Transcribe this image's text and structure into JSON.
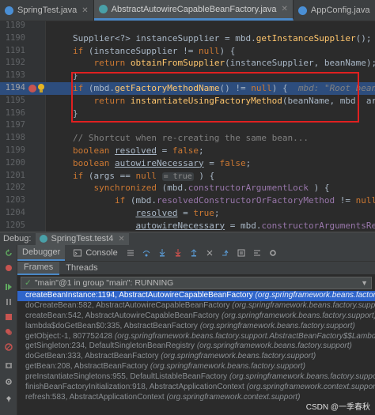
{
  "tabs": [
    {
      "label": "SpringTest.java",
      "icon": "class-icon"
    },
    {
      "label": "AbstractAutowireCapableBeanFactory.java",
      "icon": "abstract-class-icon"
    },
    {
      "label": "AppConfig.java",
      "icon": "class-icon"
    }
  ],
  "editor": {
    "lines": [
      {
        "num": "1189",
        "code": ""
      },
      {
        "num": "1190",
        "code": "Supplier<?> instanceSupplier = mbd.getInstanceSupplier();  instance"
      },
      {
        "num": "1191",
        "code": "if (instanceSupplier != null) {"
      },
      {
        "num": "1192",
        "code": "    return obtainFromSupplier(instanceSupplier, beanName);  instance"
      },
      {
        "num": "1193",
        "code": "}"
      },
      {
        "num": "1194",
        "code": "if (mbd.getFactoryMethodName() != null) {  mbd: \"Root bean: class"
      },
      {
        "num": "1195",
        "code": "    return instantiateUsingFactoryMethod(beanName, mbd, args);"
      },
      {
        "num": "1196",
        "code": "}"
      },
      {
        "num": "1197",
        "code": ""
      },
      {
        "num": "1198",
        "code": "// Shortcut when re-creating the same bean..."
      },
      {
        "num": "1199",
        "code": "boolean resolved = false;"
      },
      {
        "num": "1200",
        "code": "boolean autowireNecessary = false;"
      },
      {
        "num": "1201",
        "code": "if (args == null = true ) {"
      },
      {
        "num": "1202",
        "code": "    synchronized (mbd.constructorArgumentLock) {"
      },
      {
        "num": "1203",
        "code": "        if (mbd.resolvedConstructorOrFactoryMethod != null) {"
      },
      {
        "num": "1204",
        "code": "            resolved = true;"
      },
      {
        "num": "1205",
        "code": "            autowireNecessary = mbd.constructorArgumentsResolved;"
      },
      {
        "num": "1206",
        "code": "        }"
      }
    ],
    "highlight_line": "1194"
  },
  "debug": {
    "label": "Debug:",
    "run_tab": "SpringTest.test4",
    "tabs": [
      "Debugger",
      "Console"
    ],
    "frame_tabs": [
      "Frames",
      "Threads"
    ],
    "thread": "\"main\"@1 in group \"main\": RUNNING",
    "frames": [
      {
        "method": "createBeanInstance:1194, AbstractAutowireCapableBeanFactory",
        "pkg": "(org.springframework.beans.factory.support)"
      },
      {
        "method": "doCreateBean:582, AbstractAutowireCapableBeanFactory",
        "pkg": "(org.springframework.beans.factory.support)"
      },
      {
        "method": "createBean:542, AbstractAutowireCapableBeanFactory",
        "pkg": "(org.springframework.beans.factory.support)"
      },
      {
        "method": "lambda$doGetBean$0:335, AbstractBeanFactory",
        "pkg": "(org.springframework.beans.factory.support)"
      },
      {
        "method": "getObject:-1, 807752428",
        "pkg": "(org.springframework.beans.factory.support.AbstractBeanFactory$$Lambda$34)"
      },
      {
        "method": "getSingleton:234, DefaultSingletonBeanRegistry",
        "pkg": "(org.springframework.beans.factory.support)"
      },
      {
        "method": "doGetBean:333, AbstractBeanFactory",
        "pkg": "(org.springframework.beans.factory.support)"
      },
      {
        "method": "getBean:208, AbstractBeanFactory",
        "pkg": "(org.springframework.beans.factory.support)"
      },
      {
        "method": "preInstantiateSingletons:955, DefaultListableBeanFactory",
        "pkg": "(org.springframework.beans.factory.support)"
      },
      {
        "method": "finishBeanFactoryInitialization:918, AbstractApplicationContext",
        "pkg": "(org.springframework.context.support)"
      },
      {
        "method": "refresh:583, AbstractApplicationContext",
        "pkg": "(org.springframework.context.support)"
      }
    ]
  },
  "watermark": "CSDN @一季春秋",
  "colors": {
    "accent": "#4a88c7",
    "selection": "#2f65ca",
    "highlight_line": "#2d4d7d",
    "annotation_box": "#e02020"
  }
}
